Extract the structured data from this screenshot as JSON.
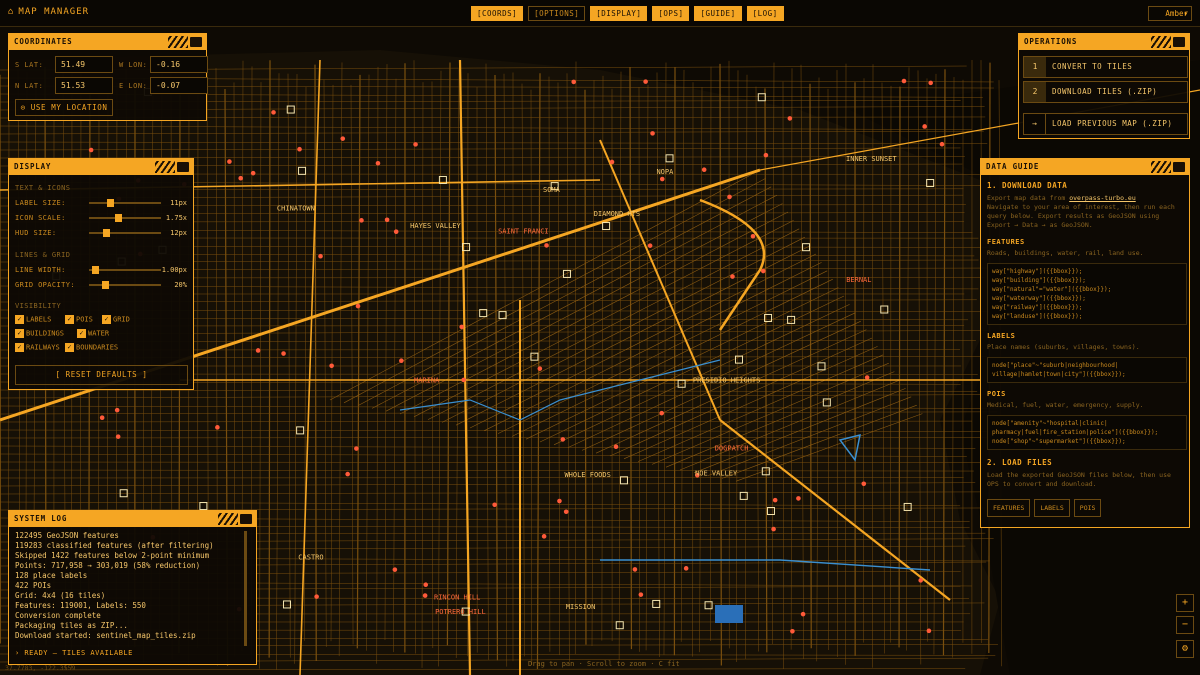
{
  "app": {
    "title": "MAP MANAGER",
    "theme": "Amber"
  },
  "nav": [
    {
      "label": "[COORDS]",
      "active": true
    },
    {
      "label": "[OPTIONS]",
      "active": false
    },
    {
      "label": "[DISPLAY]",
      "active": true
    },
    {
      "label": "[OPS]",
      "active": true
    },
    {
      "label": "[GUIDE]",
      "active": true
    },
    {
      "label": "[LOG]",
      "active": true
    }
  ],
  "coords": {
    "title": "COORDINATES",
    "s_lat_label": "S LAT:",
    "s_lat": "51.49",
    "w_lon_label": "W LON:",
    "w_lon": "-0.16",
    "n_lat_label": "N LAT:",
    "n_lat": "51.53",
    "e_lon_label": "E LON:",
    "e_lon": "-0.07",
    "locate": "⊙ USE MY LOCATION"
  },
  "display": {
    "title": "DISPLAY",
    "text_icons": "TEXT & ICONS",
    "label_size": {
      "label": "LABEL SIZE:",
      "value": "11px",
      "level": 0.28
    },
    "icon_size": {
      "label": "ICON SCALE:",
      "value": "1.75x",
      "level": 0.4
    },
    "hud_size": {
      "label": "HUD SIZE:",
      "value": "12px",
      "level": 0.22
    },
    "lines_grid": "LINES & GRID",
    "line_width": {
      "label": "LINE WIDTH:",
      "value": "1.00px",
      "level": 0.05
    },
    "grid_opacity": {
      "label": "GRID OPACITY:",
      "value": "20%",
      "level": 0.2
    },
    "visibility": "VISIBILITY",
    "checks": [
      "LABELS",
      "POIS",
      "GRID",
      "BUILDINGS",
      "WATER",
      "RAILWAYS",
      "BOUNDARIES"
    ],
    "reset": "[ RESET DEFAULTS ]"
  },
  "log": {
    "title": "SYSTEM LOG",
    "lines": [
      "122495 GeoJSON features",
      "119283 classified features (after filtering)",
      "Skipped 1422 features below 2-point minimum",
      "Points: 717,958 → 303,019 (58% reduction)",
      "128 place labels",
      "422 POIs",
      "Grid: 4x4 (16 tiles)",
      "Features: 119001, Labels: 550",
      "Conversion complete",
      "Packaging tiles as ZIP...",
      "Download started: sentinel_map_tiles.zip"
    ],
    "status": "› READY — TILES AVAILABLE"
  },
  "ops": {
    "title": "OPERATIONS",
    "items": [
      {
        "num": "1",
        "label": "CONVERT TO TILES"
      },
      {
        "num": "2",
        "label": "DOWNLOAD TILES (.ZIP)"
      },
      {
        "num": "→",
        "label": "LOAD PREVIOUS MAP (.ZIP)"
      }
    ]
  },
  "guide": {
    "title": "DATA GUIDE",
    "s1": "1. DOWNLOAD DATA",
    "t1a": "Export map data from",
    "link": "overpass-turbo.eu",
    "t1b": "Navigate to your area of interest, then run each",
    "t1c": "query below. Export results as GeoJSON using",
    "t1d": "Export → Data → as GeoJSON.",
    "features_h": "FEATURES",
    "features_t": "Roads, buildings, water, rail, land use.",
    "features_code": "way[\"highway\"]({{bbox}});\nway[\"building\"]({{bbox}});\nway[\"natural\"=\"water\"]({{bbox}});\nway[\"waterway\"]({{bbox}});\nway[\"railway\"]({{bbox}});\nway[\"landuse\"]({{bbox}});",
    "labels_h": "LABELS",
    "labels_t": "Place names (suburbs, villages, towns).",
    "labels_code": "node[\"place\"~\"suburb|neighbourhood|\nvillage|hamlet|town|city\"]({{bbox}});",
    "pois_h": "POIS",
    "pois_t": "Medical, fuel, water, emergency, supply.",
    "pois_code": "node[\"amenity\"~\"hospital|clinic|\npharmacy|fuel|fire_station|police\"]({{bbox}});\nnode[\"shop\"~\"supermarket\"]({{bbox}});",
    "s2": "2. LOAD FILES",
    "t2a": "Load the exported GeoJSON files below, then use",
    "t2b": "OPS to convert and download.",
    "buttons": [
      "FEATURES",
      "LABELS",
      "POIS"
    ]
  },
  "map": {
    "labels": [
      "MARINA",
      "PRESIDIO HEIGHTS",
      "HAYES VALLEY",
      "SAINT FRANCI",
      "NOPA",
      "CHINATOWN",
      "RINCON HILL",
      "SOMA",
      "WHOLE FOODS",
      "POTRERO HILL",
      "MISSION",
      "INNER SUNSET",
      "DOGPATCH",
      "CASTRO",
      "NOE VALLEY",
      "BERNAL",
      "DIAMOND HTS"
    ],
    "hint": "Drag to pan · Scroll to zoom · C fit",
    "cursor": "37.7783, -122.3559"
  }
}
